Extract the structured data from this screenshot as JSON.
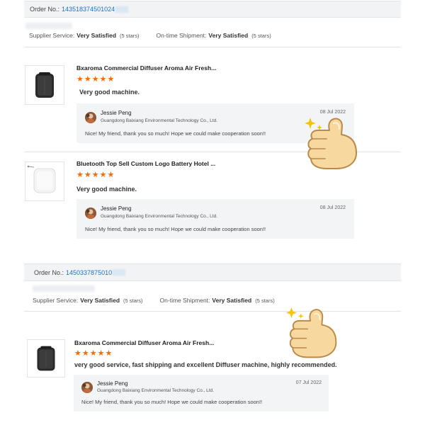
{
  "orders": [
    {
      "order_label": "Order No.:",
      "order_number": "143518374501024",
      "satisfaction": {
        "supplier_label": "Supplier Service:",
        "supplier_value": "Very Satisfied",
        "supplier_stars": "(5 stars)",
        "shipment_label": "On-time Shipment:",
        "shipment_value": "Very Satisfied",
        "shipment_stars": "(5 stars)"
      },
      "items": [
        {
          "title": "Bxaroma Commercial Diffuser Aroma Air Fresh...",
          "stars": "★★★★★",
          "review": "Very good machine.",
          "reply": {
            "name": "Jessie Peng",
            "company": "Guangdong Baixiang Environmental Technology Co., Ltd.",
            "date": "08 Jul 2022",
            "message": "Nice! My friend, thank you so much! Hope we could make cooperation soon!!"
          }
        },
        {
          "title": "Bluetooth Top Sell Custom Logo Battery Hotel ...",
          "stars": "★★★★★",
          "review": "Very good machine.",
          "reply": {
            "name": "Jessie Peng",
            "company": "Guangdong Baixiang Environmental Technology Co., Ltd.",
            "date": "08 Jul 2022",
            "message": "Nice! My friend, thank you so much! Hope we could make cooperation soon!!"
          }
        }
      ]
    },
    {
      "order_label": "Order No.:",
      "order_number": "1450337875010",
      "satisfaction": {
        "supplier_label": "Supplier Service:",
        "supplier_value": "Very Satisfied",
        "supplier_stars": "(5 stars)",
        "shipment_label": "On-time Shipment:",
        "shipment_value": "Very Satisfied",
        "shipment_stars": "(5 stars)"
      },
      "items": [
        {
          "title": "Bxaroma Commercial Diffuser Aroma Air Fresh...",
          "stars": "★★★★★",
          "review": "very good service, fast shipping and excellent Diffuser machine, highly recommended.",
          "reply": {
            "name": "Jessie Peng",
            "company": "Guangdong Baixiang Environmental Technology Co., Ltd.",
            "date": "07 Jul 2022",
            "message": "Nice! My friend, thank you so much! Hope we could make cooperation soon!!"
          }
        }
      ]
    }
  ],
  "colors": {
    "link": "#1a73c8",
    "star": "#ff6a00",
    "reply_bg": "#f3f4f6",
    "bar_bg": "#f2f3f5"
  },
  "icons": [
    "thumbs-up-icon",
    "sparkle-icon",
    "diffuser-black-image",
    "diffuser-white-image"
  ]
}
